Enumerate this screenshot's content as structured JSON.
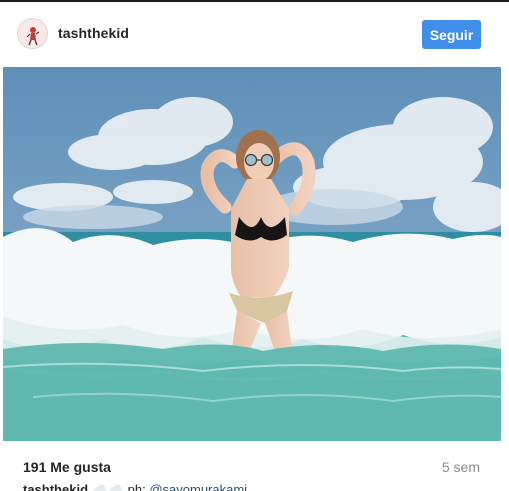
{
  "post": {
    "username": "tashthekid",
    "follow_label": "Seguir",
    "likes": "191 Me gusta",
    "time_ago": "5 sem",
    "caption": {
      "username": "tashthekid",
      "text": "☁️☁️ ph:",
      "mention": "@sayomurakami"
    }
  },
  "colors": {
    "follow_button": "#3f8ee9",
    "text": "#262626",
    "muted": "#8a8a8a",
    "mention": "#1f4e79"
  }
}
